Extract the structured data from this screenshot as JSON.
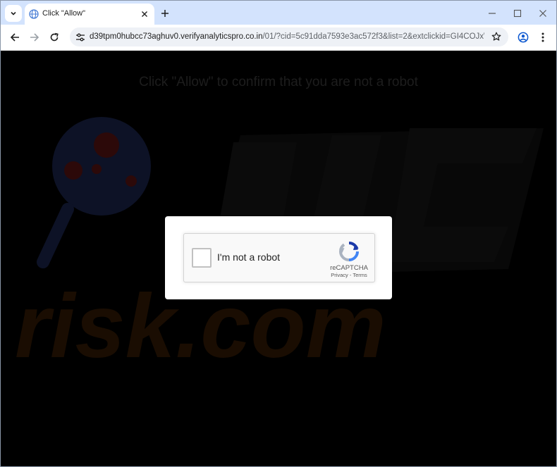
{
  "browser": {
    "tab": {
      "title": "Click \"Allow\""
    },
    "address_bar": {
      "url_host": "d39tpm0hubcc73aghuv0.verifyanalyticspro.co.in",
      "url_path": "/01/?cid=5c91dda7593e3ac572f3&list=2&extclickid=GI4COJxWa..."
    }
  },
  "page": {
    "headline": "Click \"Allow\" to confirm that you are not a robot",
    "watermark": "risk.com"
  },
  "captcha": {
    "label": "I'm not a robot",
    "brand": "reCAPTCHA",
    "privacy": "Privacy",
    "separator": " - ",
    "terms": "Terms",
    "checked": false
  },
  "colors": {
    "tabstrip": "#d3e3fd",
    "page_background": "#000000",
    "headline_text": "#1d1d1d",
    "card": "#ffffff"
  }
}
